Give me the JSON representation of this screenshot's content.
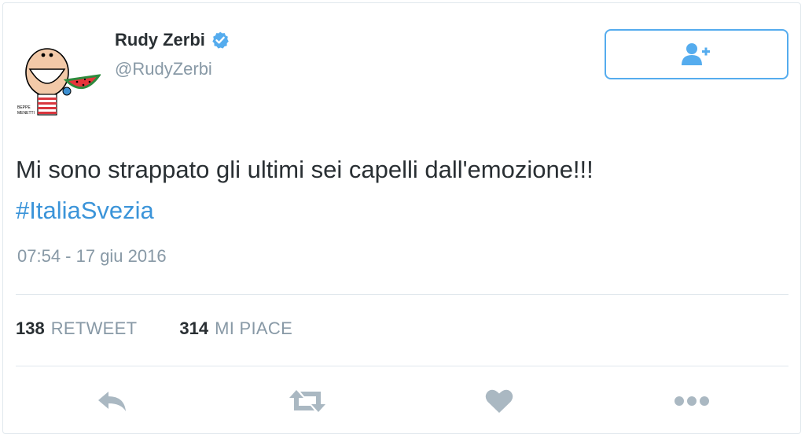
{
  "user": {
    "name": "Rudy Zerbi",
    "handle": "@RudyZerbi",
    "verified": true,
    "avatar_signature": "BEPPE MENETTI"
  },
  "follow_button": {
    "icon": "follow-user-plus-icon"
  },
  "tweet": {
    "text": "Mi sono strappato gli ultimi sei capelli dall'emozione!!!",
    "hashtag": "#ItaliaSvezia",
    "timestamp": "07:54 - 17 giu 2016"
  },
  "stats": {
    "retweets": {
      "count": "138",
      "label": "RETWEET"
    },
    "likes": {
      "count": "314",
      "label": "MI PIACE"
    }
  },
  "actions": [
    {
      "name": "reply",
      "icon": "reply-icon"
    },
    {
      "name": "retweet",
      "icon": "retweet-icon"
    },
    {
      "name": "like",
      "icon": "heart-icon"
    },
    {
      "name": "more",
      "icon": "more-dots-icon"
    }
  ],
  "colors": {
    "accent": "#55acee",
    "link": "#3b94d9",
    "muted": "#8899a6",
    "icon": "#aab8c2",
    "text": "#292f33",
    "border": "#e1e8ed"
  }
}
